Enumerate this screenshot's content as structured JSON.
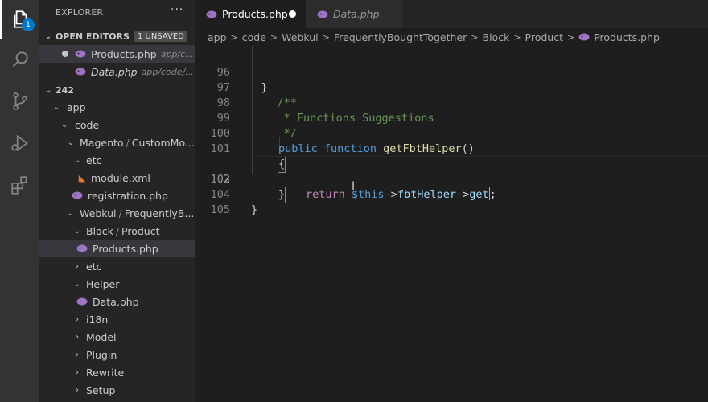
{
  "activity_bar": {
    "explorer_badge": "1",
    "items": [
      "files-icon",
      "search-icon",
      "source-control-icon",
      "run-debug-icon",
      "extensions-icon"
    ]
  },
  "sidebar": {
    "title": "EXPLORER",
    "more": "···",
    "open_editors": {
      "label": "OPEN EDITORS",
      "badge": "1 UNSAVED",
      "items": [
        {
          "name": "Products.php",
          "path": "app/c..."
        },
        {
          "name": "Data.php",
          "path": "app/code/..."
        }
      ]
    },
    "workspace": {
      "label": "242",
      "tree": {
        "app": "app",
        "code": "code",
        "magento": {
          "a": "Magento",
          "b": "CustomMo..."
        },
        "etc1": "etc",
        "module_xml": "module.xml",
        "registration": "registration.php",
        "webkul": {
          "a": "Webkul",
          "b": "FrequentlyB..."
        },
        "block": {
          "a": "Block",
          "b": "Product"
        },
        "products": "Products.php",
        "etc2": "etc",
        "helper": "Helper",
        "data": "Data.php",
        "i18n": "i18n",
        "model": "Model",
        "plugin": "Plugin",
        "rewrite": "Rewrite",
        "setup": "Setup"
      }
    }
  },
  "tabs": [
    {
      "label": "Products.php",
      "active": true,
      "unsaved": true
    },
    {
      "label": "Data.php",
      "active": false
    }
  ],
  "breadcrumb": [
    "app",
    "code",
    "Webkul",
    "FrequentlyBoughtTogether",
    "Block",
    "Product",
    "Products.php"
  ],
  "editor": {
    "lines": [
      {
        "n": "96",
        "t": "    }"
      },
      {
        "n": "97",
        "t": "    /**"
      },
      {
        "n": "98",
        "t": "     * Functions Suggestions"
      },
      {
        "n": "99",
        "t": "     */"
      },
      {
        "n": "100",
        "kw1": "public",
        "kw2": "function",
        "fn": "getFbtHelper",
        "rest": "()"
      },
      {
        "n": "101",
        "t": "{"
      },
      {
        "n": "102",
        "ret": "return",
        "var": "$this",
        "arrow1": "->",
        "prop": "fbtHelper",
        "arrow2": "->",
        "fn": "get",
        "end": ";"
      },
      {
        "n": "103",
        "t": "}"
      },
      {
        "n": "104",
        "t": "}"
      },
      {
        "n": "105",
        "t": ""
      }
    ]
  },
  "colors": {
    "accent": "#007acc",
    "php_icon": "#a074c4",
    "comment": "#6a9955",
    "keyword": "#569cd6",
    "function": "#dcdcaa"
  }
}
